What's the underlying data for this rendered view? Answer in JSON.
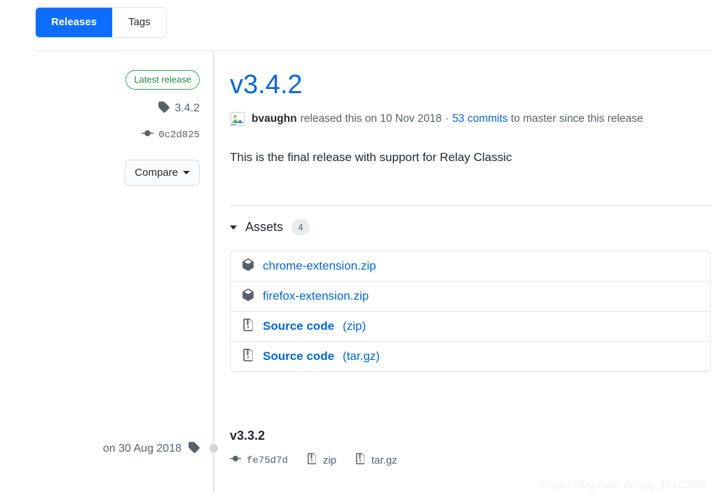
{
  "tabs": [
    {
      "label": "Releases",
      "active": true
    },
    {
      "label": "Tags",
      "active": false
    }
  ],
  "latest_release": {
    "badge": "Latest release",
    "tag": "3.4.2",
    "commit": "0c2d825",
    "compare_label": "Compare",
    "title": "v3.4.2",
    "author": "bvaughn",
    "released_text": "released this on 10 Nov 2018",
    "separator": "·",
    "commits_link": "53 commits",
    "commits_suffix": "to master since this release",
    "description": "This is the final release with support for Relay Classic",
    "assets": {
      "label": "Assets",
      "count": "4",
      "items": [
        {
          "icon": "package-icon",
          "name": "chrome-extension.zip",
          "ext": ""
        },
        {
          "icon": "package-icon",
          "name": "firefox-extension.zip",
          "ext": ""
        },
        {
          "icon": "file-zip-icon",
          "name": "Source code",
          "ext": "(zip)"
        },
        {
          "icon": "file-zip-icon",
          "name": "Source code",
          "ext": "(tar.gz)"
        }
      ]
    }
  },
  "previous_release": {
    "date": "on 30 Aug 2018",
    "title": "v3.3.2",
    "commit": "fe75d7d",
    "downloads": [
      "zip",
      "tar.gz"
    ]
  },
  "watermark": "https://blog.csdn.net/qq_46112580",
  "colors": {
    "accent_blue": "#0366d6",
    "tab_active_blue": "#0d6efd",
    "badge_green": "#2ea44f",
    "border_gray": "#e1e4e8",
    "muted_text": "#586069"
  }
}
